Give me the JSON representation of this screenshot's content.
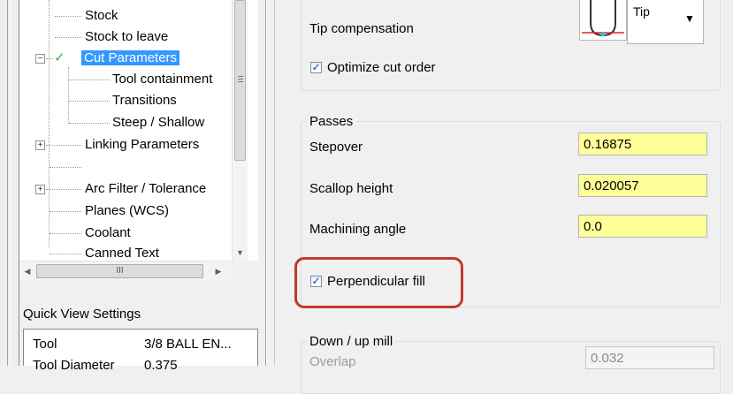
{
  "tree": {
    "items": [
      {
        "label": "Stock",
        "state": "normal"
      },
      {
        "label": "Stock to leave",
        "state": "normal"
      },
      {
        "label": "Cut Parameters",
        "state": "selected",
        "checked": true,
        "expander": "minus"
      },
      {
        "label": "Tool containment",
        "state": "normal"
      },
      {
        "label": "Transitions",
        "state": "normal"
      },
      {
        "label": "Steep / Shallow",
        "state": "normal"
      },
      {
        "label": "Linking Parameters",
        "state": "normal",
        "expander": "plus"
      },
      {
        "label": "",
        "state": "normal"
      },
      {
        "label": "Arc Filter / Tolerance",
        "state": "normal",
        "expander": "plus"
      },
      {
        "label": "Planes (WCS)",
        "state": "normal"
      },
      {
        "label": "Coolant",
        "state": "normal"
      },
      {
        "label": "Canned Text",
        "state": "normal"
      }
    ],
    "expander_minus": "−",
    "expander_plus": "+",
    "check_glyph": "✓"
  },
  "scrollbars": {
    "down_arrow": "▼",
    "left_arrow": "◀",
    "right_arrow": "▶",
    "thumb_grip": "III"
  },
  "quick_view": {
    "title": "Quick View Settings",
    "rows": [
      {
        "key": "Tool",
        "value": "3/8 BALL EN..."
      },
      {
        "key": "Tool Diameter",
        "value": "0.375"
      }
    ]
  },
  "cut_params": {
    "tip_compensation_label": "Tip compensation",
    "tip_compensation_value": "Tip",
    "dropdown_arrow": "▼",
    "optimize_cut_order_label": "Optimize cut order",
    "optimize_cut_order_checked": true
  },
  "passes": {
    "title": "Passes",
    "stepover_label": "Stepover",
    "stepover_value": "0.16875",
    "scallop_height_label": "Scallop height",
    "scallop_height_value": "0.020057",
    "machining_angle_label": "Machining angle",
    "machining_angle_value": "0.0",
    "perpendicular_fill_label": "Perpendicular fill",
    "perpendicular_fill_checked": true
  },
  "down_up_mill": {
    "title": "Down / up mill",
    "overlap_label": "Overlap",
    "overlap_value": "0.032"
  },
  "colors": {
    "selection": "#3399ff",
    "field_yellow": "#ffff99",
    "highlight_ring": "#c0392b",
    "check_green": "#39a845"
  }
}
